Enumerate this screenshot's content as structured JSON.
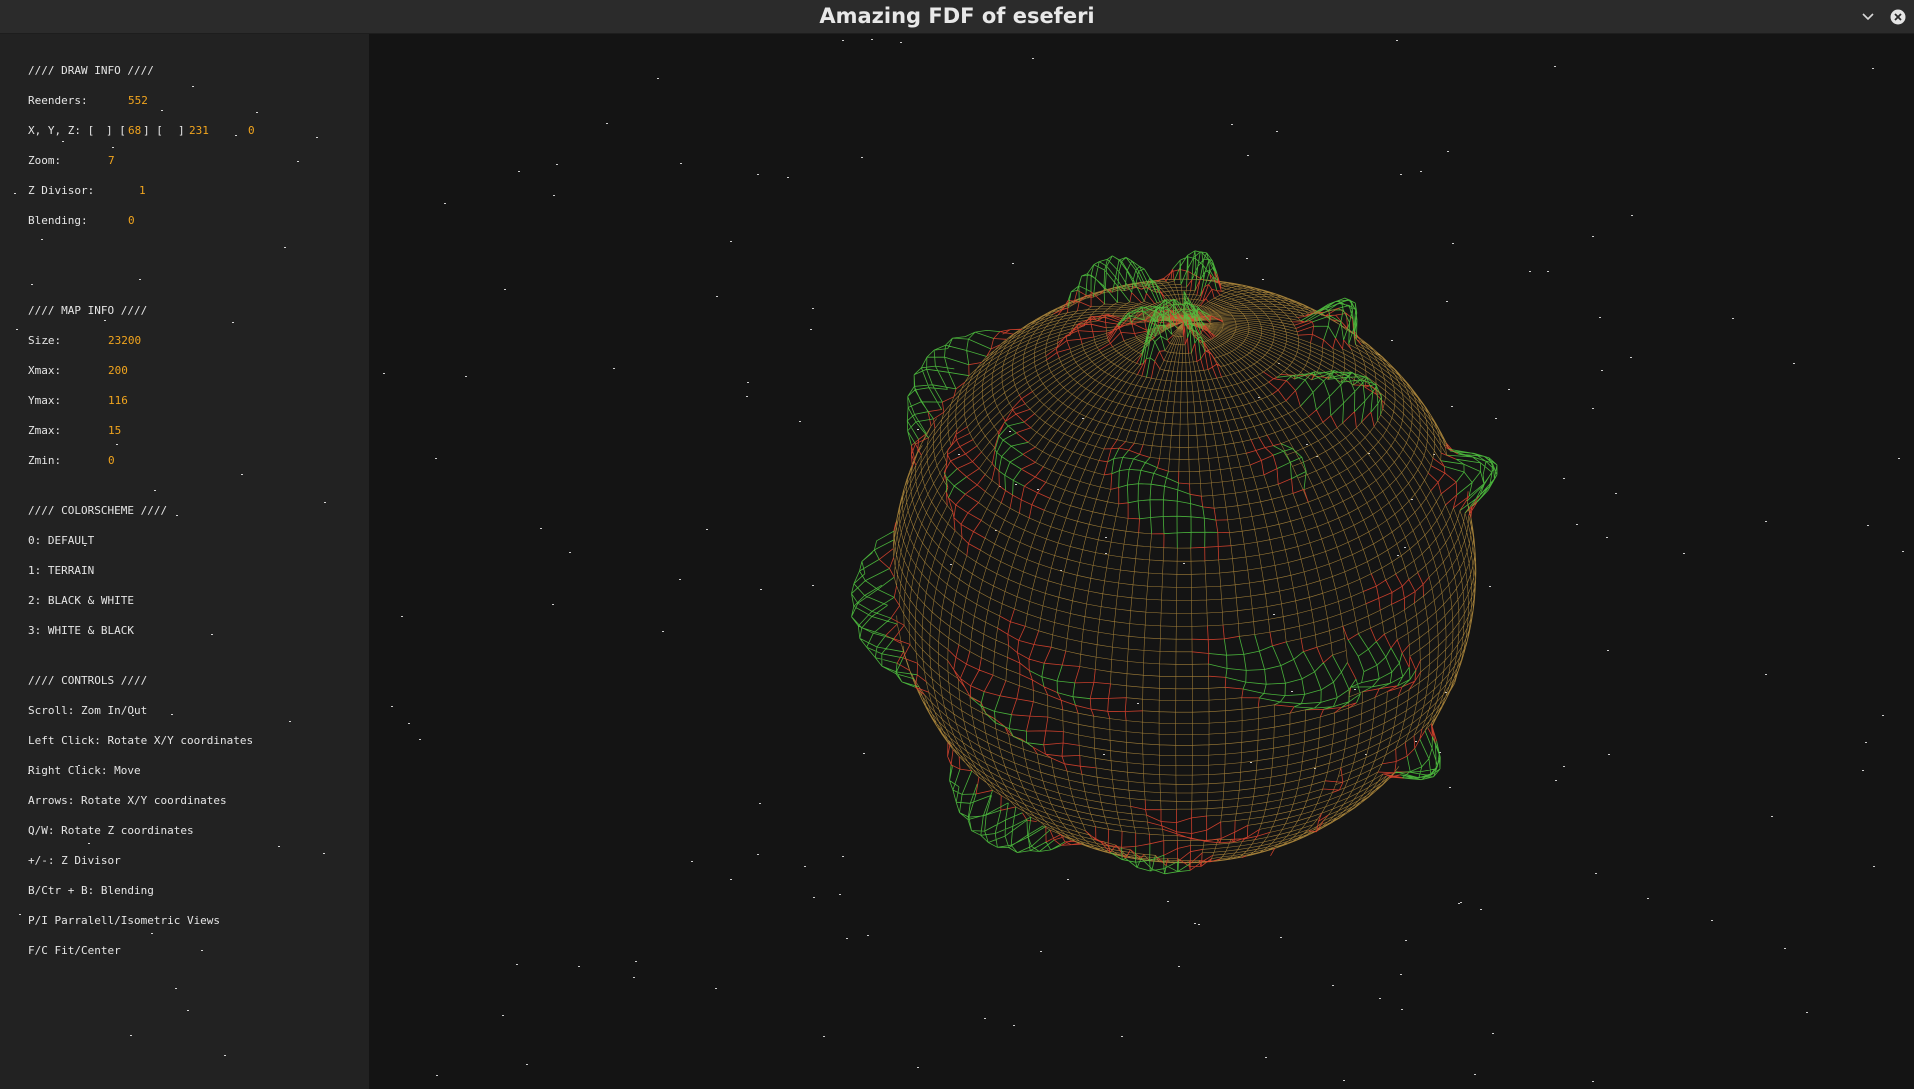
{
  "window": {
    "title": "Amazing FDF of eseferi",
    "minimize_icon": "chevron-down-icon",
    "close_icon": "close-icon"
  },
  "draw_info": {
    "header": "//// DRAW INFO ////",
    "reenders_label": "Reenders:",
    "reenders_value": "552",
    "xyz_label": "X, Y, Z: [",
    "xyz_bracket_1": "] [",
    "xyz_x": "68",
    "xyz_bracket_2": "] [",
    "xyz_bracket_3": "]",
    "xyz_y": "231",
    "xyz_z": "0",
    "zoom_label": "Zoom:",
    "zoom_value": "7",
    "zdiv_label": "Z Divisor:",
    "zdiv_value": "1",
    "blending_label": "Blending:",
    "blending_value": "0"
  },
  "map_info": {
    "header": "//// MAP INFO ////",
    "size_label": "Size:",
    "size_value": "23200",
    "xmax_label": "Xmax:",
    "xmax_value": "200",
    "ymax_label": "Ymax:",
    "ymax_value": "116",
    "zmax_label": "Zmax:",
    "zmax_value": "15",
    "zmin_label": "Zmin:",
    "zmin_value": "0"
  },
  "colorscheme": {
    "header": "//// COLORSCHEME ////",
    "items": [
      "0: DEFAULT",
      "1: TERRAIN",
      "2: BLACK & WHITE",
      "3: WHITE & BLACK"
    ]
  },
  "controls": {
    "header": "//// CONTROLS ////",
    "items": [
      "Scroll: Zom In/Out",
      "Left Click: Rotate X/Y coordinates",
      "Right Click: Move",
      "Arrows: Rotate X/Y coordinates",
      "Q/W: Rotate Z coordinates",
      "+/-: Z Divisor",
      "B/Ctr + B: Blending",
      "P/I Parralell/Isometric Views",
      "F/C Fit/Center"
    ]
  },
  "colors": {
    "label": "#e6e6e6",
    "value": "#f2a51e",
    "sidebar_bg": "#222222",
    "viewport_bg": "#141414",
    "wire_base": "#b08a3c",
    "wire_red": "#d9432e",
    "wire_green": "#4fc23f"
  }
}
